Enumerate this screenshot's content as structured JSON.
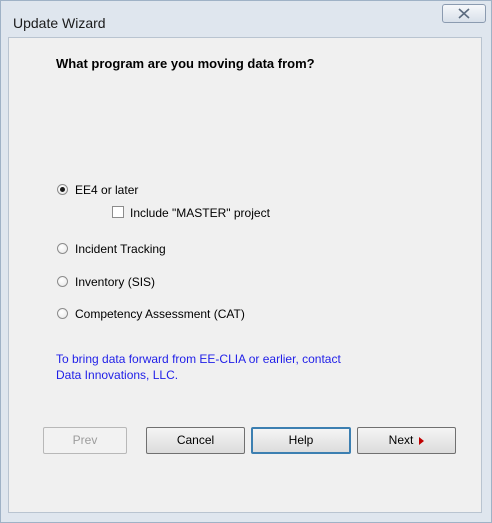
{
  "window": {
    "title": "Update Wizard"
  },
  "wizard": {
    "question": "What program are you moving data from?",
    "options": [
      {
        "label": "EE4 or later",
        "selected": true
      },
      {
        "label": "Incident Tracking",
        "selected": false
      },
      {
        "label": "Inventory (SIS)",
        "selected": false
      },
      {
        "label": "Competency Assessment (CAT)",
        "selected": false
      }
    ],
    "include_master": {
      "label": "Include \"MASTER\" project",
      "checked": false
    },
    "info_line1": "To bring data forward from EE-CLIA or earlier, contact",
    "info_line2": "Data Innovations, LLC."
  },
  "buttons": {
    "prev": "Prev",
    "cancel": "Cancel",
    "help": "Help",
    "next": "Next"
  },
  "colors": {
    "info_text": "#1f1ee8",
    "next_arrow": "#c00000"
  },
  "icons": {
    "close": "close-icon",
    "next": "triangle-right-icon"
  }
}
